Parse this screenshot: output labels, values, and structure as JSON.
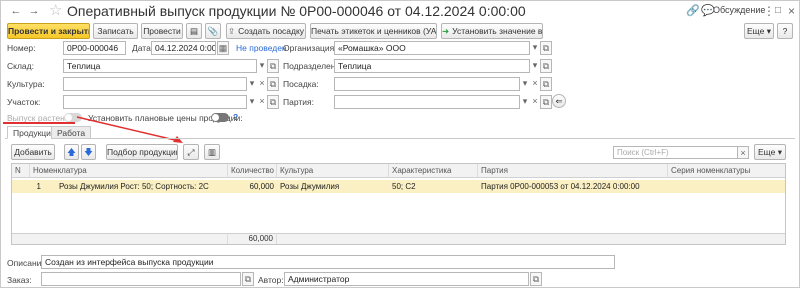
{
  "window": {
    "title": "Оперативный выпуск продукции № 0Р00-000046 от 04.12.2024 0:00:00",
    "discussion_label": "Обсуждение",
    "close_glyph": "×",
    "more_glyph": "⋮",
    "restore_glyph": "□"
  },
  "toolbar": {
    "post_and_close": "Провести и закрыть",
    "save": "Записать",
    "post": "Провести",
    "create_planting": "Создать посадку",
    "print_labels": "Печать этикеток и ценников (УАУ)",
    "set_value": "Установить значение в колонке",
    "more": "Еще",
    "help": "?"
  },
  "form": {
    "number_label": "Номер:",
    "number_value": "0Р00-000046",
    "date_label": "Дата:",
    "date_value": "04.12.2024  0:00:00",
    "status_link": "Не проведен",
    "org_label": "Организация:",
    "org_value": "«Ромашка» ООО",
    "warehouse_label": "Склад:",
    "warehouse_value": "Теплица",
    "subdivision_label": "Подразделение:",
    "subdivision_value": "Теплица",
    "culture_label": "Культура:",
    "culture_value": "",
    "planting_label": "Посадка:",
    "planting_value": "",
    "plot_label": "Участок:",
    "plot_value": "",
    "batch_label": "Партия:",
    "batch_value": "",
    "plants_release_label": "Выпуск растений:",
    "planned_prices_label": "Установить плановые цены продукции:",
    "planned_prices_help": "?"
  },
  "tabs": [
    {
      "label": "Продукция"
    },
    {
      "label": "Работа"
    }
  ],
  "table_toolbar": {
    "add": "Добавить",
    "pick_products": "Подбор продукции",
    "search_placeholder": "Поиск (Ctrl+F)",
    "more": "Еще"
  },
  "table": {
    "columns": [
      "N",
      "Номенклатура",
      "Количество",
      "Культура",
      "Характеристика",
      "Партия",
      "Серия номенклатуры"
    ],
    "rows": [
      {
        "n": "1",
        "item": "Розы Джумилия Рост: 50; Сортность: 2С",
        "qty": "60,000",
        "culture": "Розы Джумилия",
        "characteristic": "50; С2",
        "batch": "Партия 0Р00-000053 от 04.12.2024 0:00:00",
        "series": ""
      }
    ],
    "total_qty": "60,000"
  },
  "footer": {
    "description_label": "Описание:",
    "description_value": "Создан из интерфейса выпуска продукции",
    "order_label": "Заказ:",
    "order_value": "",
    "author_label": "Автор:",
    "author_value": "Администратор"
  },
  "colors": {
    "primary_button": "#f6c728",
    "selected_row": "#fbf0c4",
    "link": "#2b6ad6",
    "annotation": "#e03030"
  }
}
